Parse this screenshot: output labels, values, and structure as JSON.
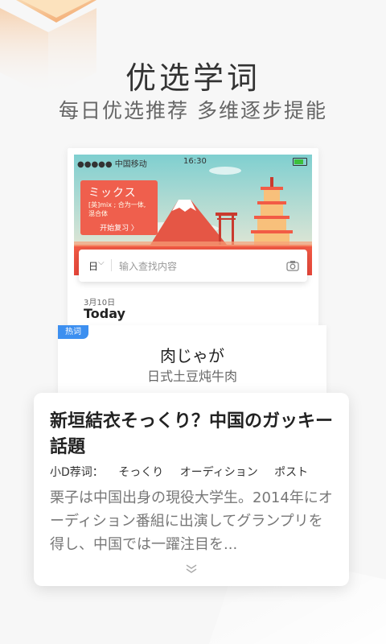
{
  "header": {
    "title": "优选学词",
    "subtitle": "每日优选推荐  多维逐步提能"
  },
  "phone": {
    "status": {
      "carrier": "●●●●● 中国移动",
      "time": "16:30"
    },
    "word_card": {
      "word": "ミックス",
      "definition_line1": "[英]mix ; 合为一体,",
      "definition_line2": "混合体",
      "action": "开始复习 〉"
    },
    "search": {
      "lang": "日",
      "placeholder": "输入查找内容"
    },
    "date": "3月10日",
    "today": "Today"
  },
  "hot_card": {
    "badge": "热词",
    "word": "肉じゃが",
    "meaning": "日式土豆炖牛肉"
  },
  "article": {
    "title": "新垣結衣そっくり？中国のガッキー話題",
    "tags_label": "小D荐词：",
    "tags": [
      "そっくり",
      "オーディション",
      "ポスト"
    ],
    "body": "栗子は中国出身の現役大学生。2014年にオーディション番組に出演してグランプリを得し、中国では一躍注目を..."
  },
  "colors": {
    "accent": "#ef5f4d",
    "badge": "#3c8ff0"
  }
}
